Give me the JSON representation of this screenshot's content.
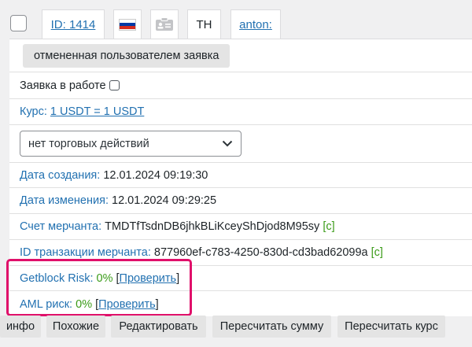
{
  "header": {
    "id_label": "ID: 1414",
    "th_label": "TH",
    "user_label": "anton:",
    "flag_colors": [
      "#ffffff",
      "#0039a6",
      "#d52b1e"
    ]
  },
  "order": {
    "status_button": "отмененная пользователем заявка",
    "in_work_label": "Заявка в работе",
    "rate_label": "Курс:",
    "rate_value": "1 USDT = 1 USDT",
    "trade_select": "нет торговых действий",
    "created_label": "Дата создания:",
    "created_value": "12.01.2024 09:19:30",
    "modified_label": "Дата изменения:",
    "modified_value": "12.01.2024 09:29:25",
    "merchant_account_label": "Счет мерчанта:",
    "merchant_account_value": "TMDTfTsdnDB6jhkBLiKceyShDjod8M95sy",
    "copy_tag": "[c]",
    "merchant_tx_label": "ID транзакции мерчанта:",
    "merchant_tx_value": "877960ef-c783-4250-830d-cd3bad62099a",
    "getblock_label": "Getblock Risk:",
    "getblock_value": "0%",
    "aml_label": "AML риск:",
    "aml_value": "0%",
    "check_link": "Проверить",
    "bracket_open": "[",
    "bracket_close": "]"
  },
  "actions": {
    "info": "инфо",
    "similar": "Похожие",
    "edit": "Редактировать",
    "recalc_sum": "Пересчитать сумму",
    "recalc_rate": "Пересчитать курс"
  },
  "colors": {
    "link": "#2271b1",
    "green": "#3a9b18",
    "highlight": "#e0106a"
  }
}
